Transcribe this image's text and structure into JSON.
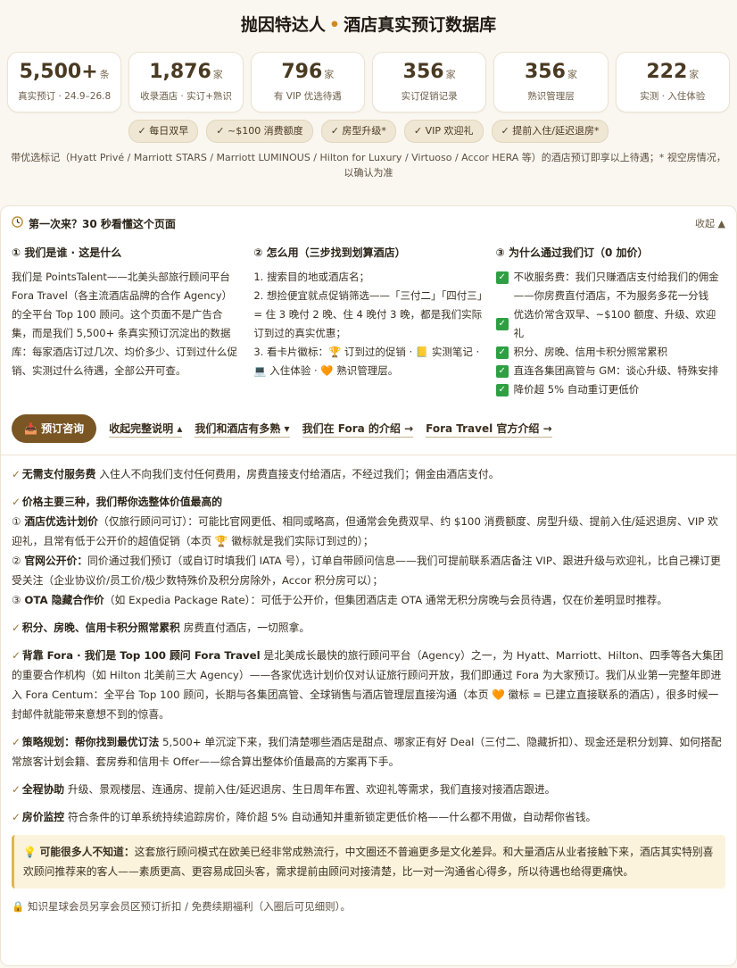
{
  "header": {
    "title_left": "抛因特达人",
    "title_dot": "•",
    "title_right": "酒店真实预订数据库"
  },
  "stats": [
    {
      "num": "5,500+",
      "unit": "条",
      "label": "真实预订 · 24.9–26.8"
    },
    {
      "num": "1,876",
      "unit": "家",
      "label": "收录酒店 · 实订+熟识"
    },
    {
      "num": "796",
      "unit": "家",
      "label": "有 VIP 优选待遇"
    },
    {
      "num": "356",
      "unit": "家",
      "label": "实订促销记录"
    },
    {
      "num": "356",
      "unit": "家",
      "label": "熟识管理层"
    },
    {
      "num": "222",
      "unit": "家",
      "label": "实测 · 入住体验"
    }
  ],
  "chips": [
    "✓ 每日双早",
    "✓ ~$100 消费额度",
    "✓ 房型升级*",
    "✓ VIP 欢迎礼",
    "✓ 提前入住/延迟退房*"
  ],
  "note_line1": "带优选标记（Hyatt Privé / Marriott STARS / Marriott LUMINOUS / Hilton for Luxury / Virtuoso / Accor HERA 等）的酒店预订即享以上待遇；* 视空房情况，",
  "note_line2": "以确认为准",
  "panel": {
    "heading": "第一次来？30 秒看懂这个页面",
    "collapse": "收起 ▲",
    "col1": {
      "title": "① 我们是谁 · 这是什么",
      "text": "我们是 PointsTalent——北美头部旅行顾问平台 Fora Travel（各主流酒店品牌的合作 Agency）的全平台 Top 100 顾问。这个页面不是广告合集，而是我们 5,500+ 条真实预订沉淀出的数据库：每家酒店订过几次、均价多少、订到过什么促销、实测过什么待遇，全部公开可查。"
    },
    "col2": {
      "title": "② 怎么用（三步找到划算酒店）",
      "step1": "1. 搜索目的地或酒店名；",
      "step2": "2. 想捡便宜就点促销筛选——「三付二」「四付三」= 住 3 晚付 2 晚、住 4 晚付 3 晚，都是我们实际订到过的真实优惠；",
      "step3": "3. 看卡片徽标：🏆 订到过的促销 · 📒 实测笔记 · 💻 入住体验 · 🧡 熟识管理层。"
    },
    "col3": {
      "title": "③ 为什么通过我们订（0 加价）",
      "items": [
        "不收服务费：我们只赚酒店支付给我们的佣金——你房费直付酒店，不为服务多花一分钱",
        "优选价常含双早、~$100 额度、升级、欢迎礼",
        "积分、房晚、信用卡积分照常累积",
        "直连各集团高管与 GM：谈心升级、特殊安排",
        "降价超 5% 自动重订更低价"
      ]
    },
    "actions": {
      "primary": "预订咨询",
      "link1": "收起完整说明 ▴",
      "link2": "我们和酒店有多熟 ▾",
      "link3": "我们在 Fora 的介绍 →",
      "link4": "Fora Travel 官方介绍 →"
    },
    "details": [
      {
        "bold": "无需支付服务费",
        "text": " 入住人不向我们支付任何费用，房费直接支付给酒店，不经过我们；佣金由酒店支付。"
      },
      {
        "bold": "价格主要三种，我们帮你选整体价值最高的",
        "text": ""
      },
      {
        "bold": "酒店优选计划价",
        "text": "（仅旅行顾问可订）：可能比官网更低、相同或略高，但通常会免费双早、约 $100 消费额度、房型升级、提前入住/延迟退房、VIP 欢迎礼，且常有低于公开价的超值促销（本页 🏆 徽标就是我们实际订到过的）；"
      },
      {
        "bold": "官网公开价：",
        "text": "同价通过我们预订（或自订时填我们 IATA 号），订单自带顾问信息——我们可提前联系酒店备注 VIP、跟进升级与欢迎礼，比自己裸订更受关注（企业协议价/员工价/极少数特殊价及积分房除外，Accor 积分房可以）；"
      },
      {
        "bold": "OTA 隐藏合作价",
        "text": "（如 Expedia Package Rate）：可低于公开价，但集团酒店走 OTA 通常无积分房晚与会员待遇，仅在价差明显时推荐。"
      },
      {
        "bold": "积分、房晚、信用卡积分照常累积",
        "text": " 房费直付酒店，一切照拿。"
      },
      {
        "bold": "背靠 Fora · 我们是 Top 100 顾问  Fora Travel",
        "text": " 是北美成长最快的旅行顾问平台（Agency）之一，为 Hyatt、Marriott、Hilton、四季等各大集团的重要合作机构（如 Hilton 北美前三大 Agency）——各家优选计划价仅对认证旅行顾问开放，我们即通过 Fora 为大家预订。我们从业第一完整年即进入 Fora Centum：全平台 Top 100 顾问，长期与各集团高管、全球销售与酒店管理层直接沟通（本页 🧡 徽标 = 已建立直接联系的酒店），很多时候一封邮件就能带来意想不到的惊喜。"
      },
      {
        "bold": "策略规划：帮你找到最优订法",
        "text": " 5,500+ 单沉淀下来，我们清楚哪些酒店是甜点、哪家正有好 Deal（三付二、隐藏折扣）、现金还是积分划算、如何搭配常旅客计划会籍、套房券和信用卡 Offer——综合算出整体价值最高的方案再下手。"
      },
      {
        "bold": "全程协助",
        "text": " 升级、景观楼层、连通房、提前入住/延迟退房、生日周年布置、欢迎礼等需求，我们直接对接酒店跟进。"
      },
      {
        "bold": "房价监控",
        "text": " 符合条件的订单系统持续追踪房价，降价超 5% 自动通知并重新锁定更低价格——什么都不用做，自动帮你省钱。"
      }
    ],
    "tip": {
      "bold": "可能很多人不知道：",
      "text": "这套旅行顾问模式在欧美已经非常成熟流行，中文圈还不普遍更多是文化差异。和大量酒店从业者接触下来，酒店其实特别喜欢顾问推荐来的客人——素质更高、更容易成回头客，需求提前由顾问对接清楚，比一对一沟通省心得多，所以待遇也给得更痛快。"
    },
    "footer": "知识星球会员另享会员区预订折扣 / 免费续期福利（入圈后可见细则）。"
  }
}
